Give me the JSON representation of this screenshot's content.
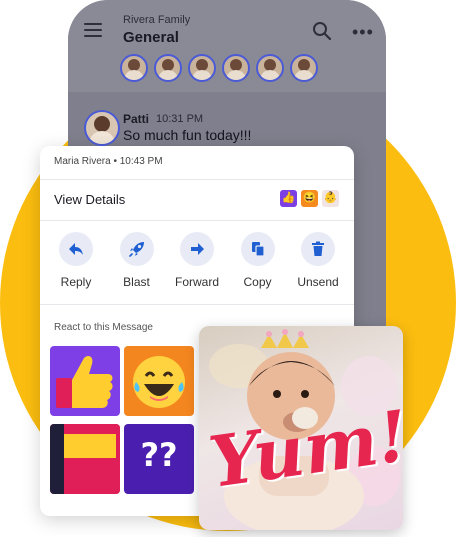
{
  "channel": {
    "family": "Rivera Family",
    "name": "General"
  },
  "message": {
    "sender": "Patti",
    "time": "10:31 PM",
    "text": "So much fun today!!!"
  },
  "menu": {
    "meta": "Maria Rivera • 10:43 PM",
    "view_details": "View Details",
    "actions": [
      {
        "label": "Reply",
        "icon": "reply-arrow-icon"
      },
      {
        "label": "Blast",
        "icon": "rocket-icon"
      },
      {
        "label": "Forward",
        "icon": "forward-arrow-icon"
      },
      {
        "label": "Copy",
        "icon": "copy-icon"
      },
      {
        "label": "Unsend",
        "icon": "trash-icon"
      }
    ],
    "react_title": "React to this Message"
  },
  "reactions": {
    "question_text": "??"
  },
  "photo": {
    "caption": "Yum!"
  },
  "colors": {
    "accent": "#1f5fd1",
    "background_circle": "#fbbd0f",
    "caption": "#e6264f"
  }
}
